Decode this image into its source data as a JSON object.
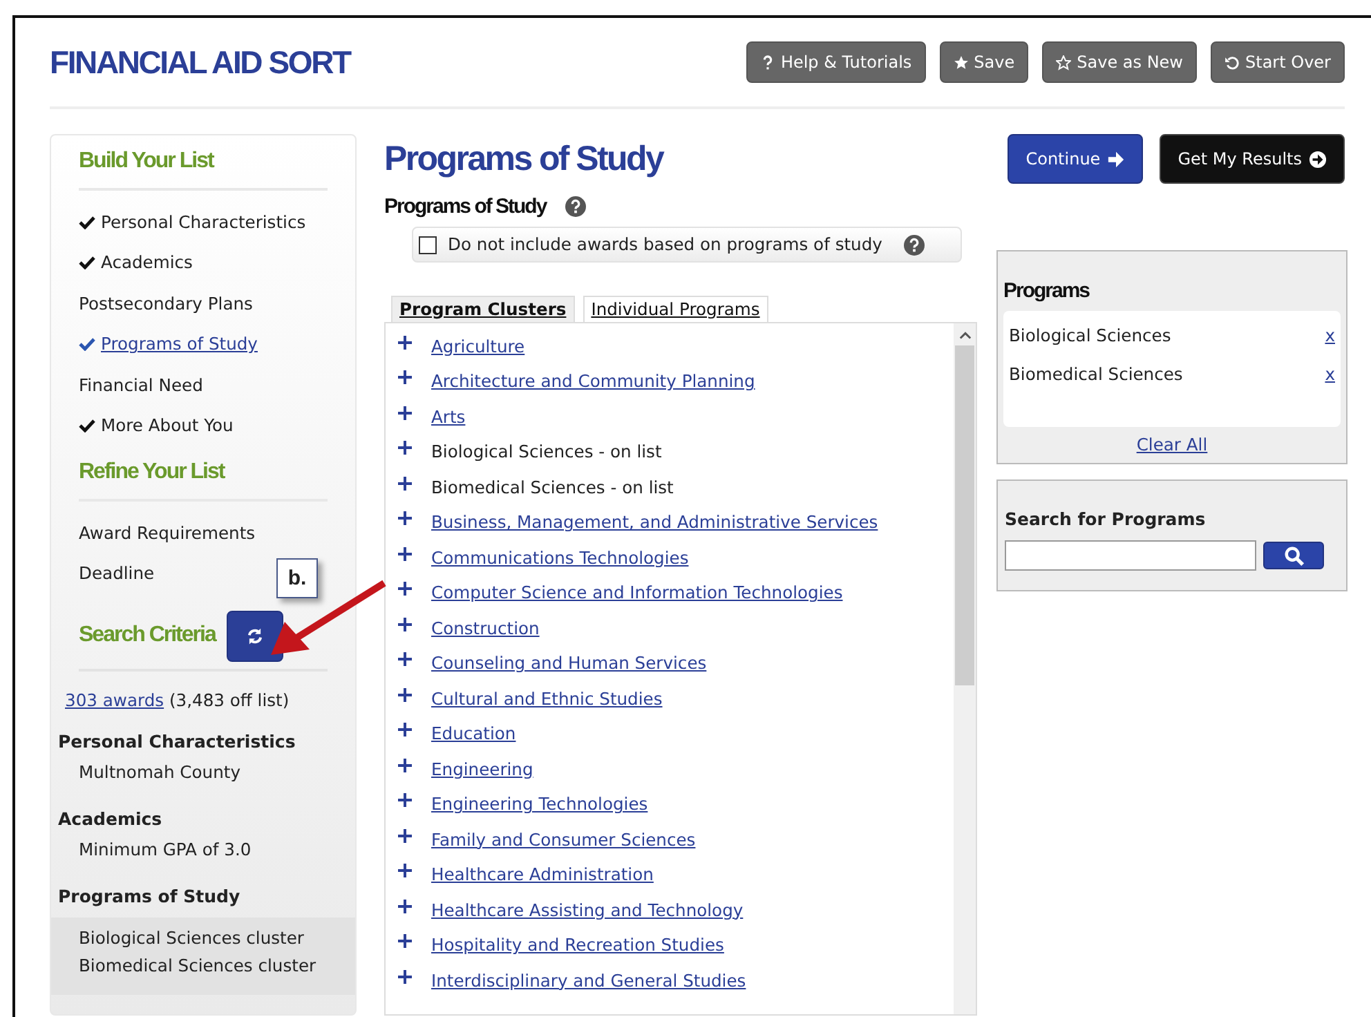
{
  "header": {
    "title": "FINANCIAL AID SORT",
    "buttons": [
      {
        "label": "Help & Tutorials",
        "kind": "question"
      },
      {
        "label": "Save",
        "kind": "star"
      },
      {
        "label": "Save as New",
        "kind": "star-outline"
      },
      {
        "label": "Start Over",
        "kind": "undo"
      }
    ]
  },
  "sidebar": {
    "build_title": "Build Your List",
    "build_items": [
      {
        "label": "Personal Characteristics",
        "checked": true,
        "selected": false
      },
      {
        "label": "Academics",
        "checked": true,
        "selected": false
      },
      {
        "label": "Postsecondary Plans",
        "checked": false,
        "selected": false
      },
      {
        "label": "Programs of Study",
        "checked": true,
        "selected": true
      },
      {
        "label": "Financial Need",
        "checked": false,
        "selected": false
      },
      {
        "label": "More About You",
        "checked": true,
        "selected": false
      }
    ],
    "refine_title": "Refine Your List",
    "refine_items": [
      "Award Requirements",
      "Deadline"
    ],
    "criteria_title": "Search Criteria",
    "awards_link": "303 awards",
    "awards_rest": "(3,483 off list)",
    "criteria_groups": [
      {
        "heading": "Personal Characteristics",
        "items": [
          "Multnomah County"
        ]
      },
      {
        "heading": "Academics",
        "items": [
          "Minimum GPA of 3.0"
        ]
      },
      {
        "heading": "Programs of Study",
        "items": [
          "Biological Sciences cluster",
          "Biomedical Sciences cluster"
        ]
      }
    ]
  },
  "annotation": {
    "label": "b."
  },
  "main": {
    "title": "Programs of Study",
    "continue": "Continue",
    "results": "Get My Results",
    "section_title": "Programs of Study",
    "exclude": {
      "label": "Do not include awards based on programs of study",
      "checked": false
    },
    "tabs": [
      {
        "label": "Program Clusters",
        "selected": true
      },
      {
        "label": "Individual Programs",
        "selected": false
      }
    ],
    "clusters": [
      {
        "label": "Agriculture",
        "on_list": false
      },
      {
        "label": "Architecture and Community Planning",
        "on_list": false
      },
      {
        "label": "Arts",
        "on_list": false
      },
      {
        "label": "Biological Sciences - on list",
        "on_list": true
      },
      {
        "label": "Biomedical Sciences - on list",
        "on_list": true
      },
      {
        "label": "Business, Management, and Administrative Services",
        "on_list": false
      },
      {
        "label": "Communications Technologies",
        "on_list": false
      },
      {
        "label": "Computer Science and Information Technologies",
        "on_list": false
      },
      {
        "label": "Construction",
        "on_list": false
      },
      {
        "label": "Counseling and Human Services",
        "on_list": false
      },
      {
        "label": "Cultural and Ethnic Studies",
        "on_list": false
      },
      {
        "label": "Education",
        "on_list": false
      },
      {
        "label": "Engineering",
        "on_list": false
      },
      {
        "label": "Engineering Technologies",
        "on_list": false
      },
      {
        "label": "Family and Consumer Sciences",
        "on_list": false
      },
      {
        "label": "Healthcare Administration",
        "on_list": false
      },
      {
        "label": "Healthcare Assisting and Technology",
        "on_list": false
      },
      {
        "label": "Hospitality and Recreation Studies",
        "on_list": false
      },
      {
        "label": "Interdisciplinary and General Studies",
        "on_list": false
      }
    ],
    "programs": {
      "title": "Programs",
      "items": [
        {
          "label": "Biological Sciences",
          "remove": "x"
        },
        {
          "label": "Biomedical Sciences",
          "remove": "x"
        }
      ],
      "clear_all": "Clear All"
    },
    "search": {
      "title": "Search for Programs"
    }
  }
}
